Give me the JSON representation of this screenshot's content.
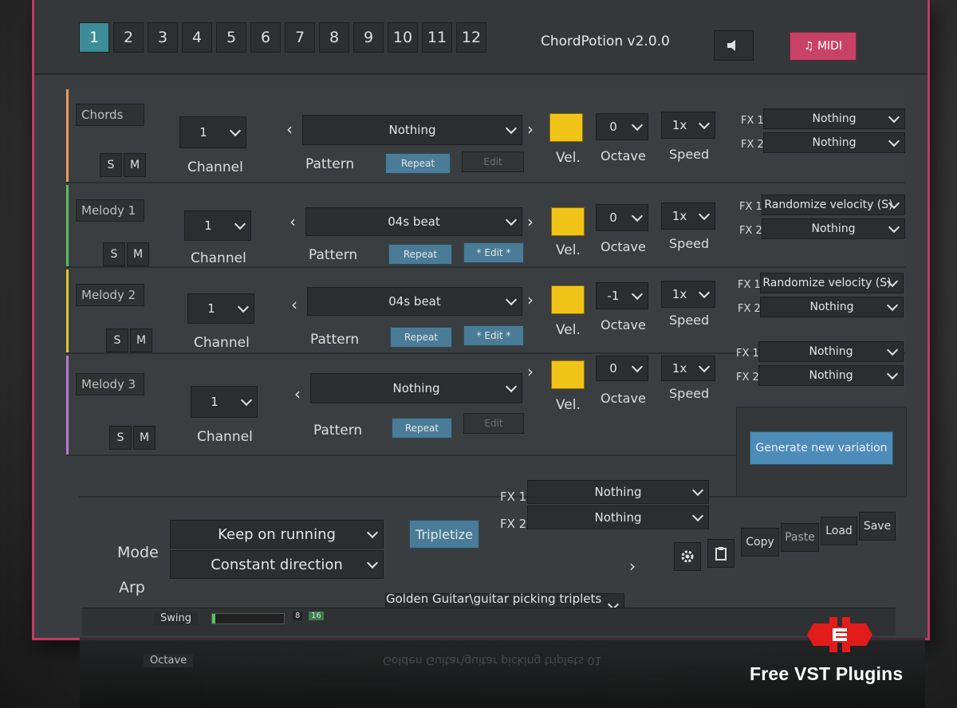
{
  "colors": {
    "accent_tab": "#3c8c9a",
    "midi": "#c84268",
    "velocity": "#f0c419",
    "chords_bar": "#e89a5a",
    "melody1_bar": "#5bbf5b",
    "melody2_bar": "#e4c62e",
    "melody3_bar": "#b07ad6"
  },
  "tabs": [
    "1",
    "2",
    "3",
    "4",
    "5",
    "6",
    "7",
    "8",
    "9",
    "10",
    "11",
    "12"
  ],
  "active_tab": "1",
  "title": "ChordPotion v2.0.0",
  "midi_label": "♫ MIDI",
  "labels": {
    "channel": "Channel",
    "pattern": "Pattern",
    "vel": "Vel.",
    "octave": "Octave",
    "speed": "Speed",
    "fx1": "FX 1",
    "fx2": "FX 2",
    "s": "S",
    "m": "M",
    "prev": "‹",
    "next": "›"
  },
  "tracks": [
    {
      "name": "Chords",
      "channel": "1",
      "pattern": "Nothing",
      "repeat": "Repeat",
      "edit": "Edit",
      "edit_active": false,
      "octave": "0",
      "speed": "1x",
      "fx1": "Nothing",
      "fx2": "Nothing"
    },
    {
      "name": "Melody 1",
      "channel": "1",
      "pattern": "04s beat",
      "repeat": "Repeat",
      "edit": "* Edit *",
      "edit_active": true,
      "octave": "0",
      "speed": "1x",
      "fx1": "Randomize velocity (S)",
      "fx2": "Nothing"
    },
    {
      "name": "Melody 2",
      "channel": "1",
      "pattern": "04s beat",
      "repeat": "Repeat",
      "edit": "* Edit *",
      "edit_active": true,
      "octave": "-1",
      "speed": "1x",
      "fx1": "Randomize velocity (S)",
      "fx2": "Nothing"
    },
    {
      "name": "Melody 3",
      "channel": "1",
      "pattern": "Nothing",
      "repeat": "Repeat",
      "edit": "Edit",
      "edit_active": false,
      "octave": "0",
      "speed": "1x",
      "fx1": "Nothing",
      "fx2": "Nothing"
    }
  ],
  "generate_label": "Generate new variation",
  "arp": {
    "mode_label": "Mode",
    "mode_value": "Keep on running",
    "arp_label": "Arp",
    "arp_value": "Constant direction",
    "tripletize": "Tripletize",
    "fx1": "Nothing",
    "fx2": "Nothing"
  },
  "preset": {
    "value": "Golden Guitar\\guitar picking triplets 01",
    "copy": "Copy",
    "paste": "Paste",
    "load": "Load",
    "save": "Save"
  },
  "sequencer": {
    "swing": "Swing",
    "octave": "Octave",
    "step8": "8",
    "step16": "16"
  },
  "brand": "Free VST Plugins"
}
